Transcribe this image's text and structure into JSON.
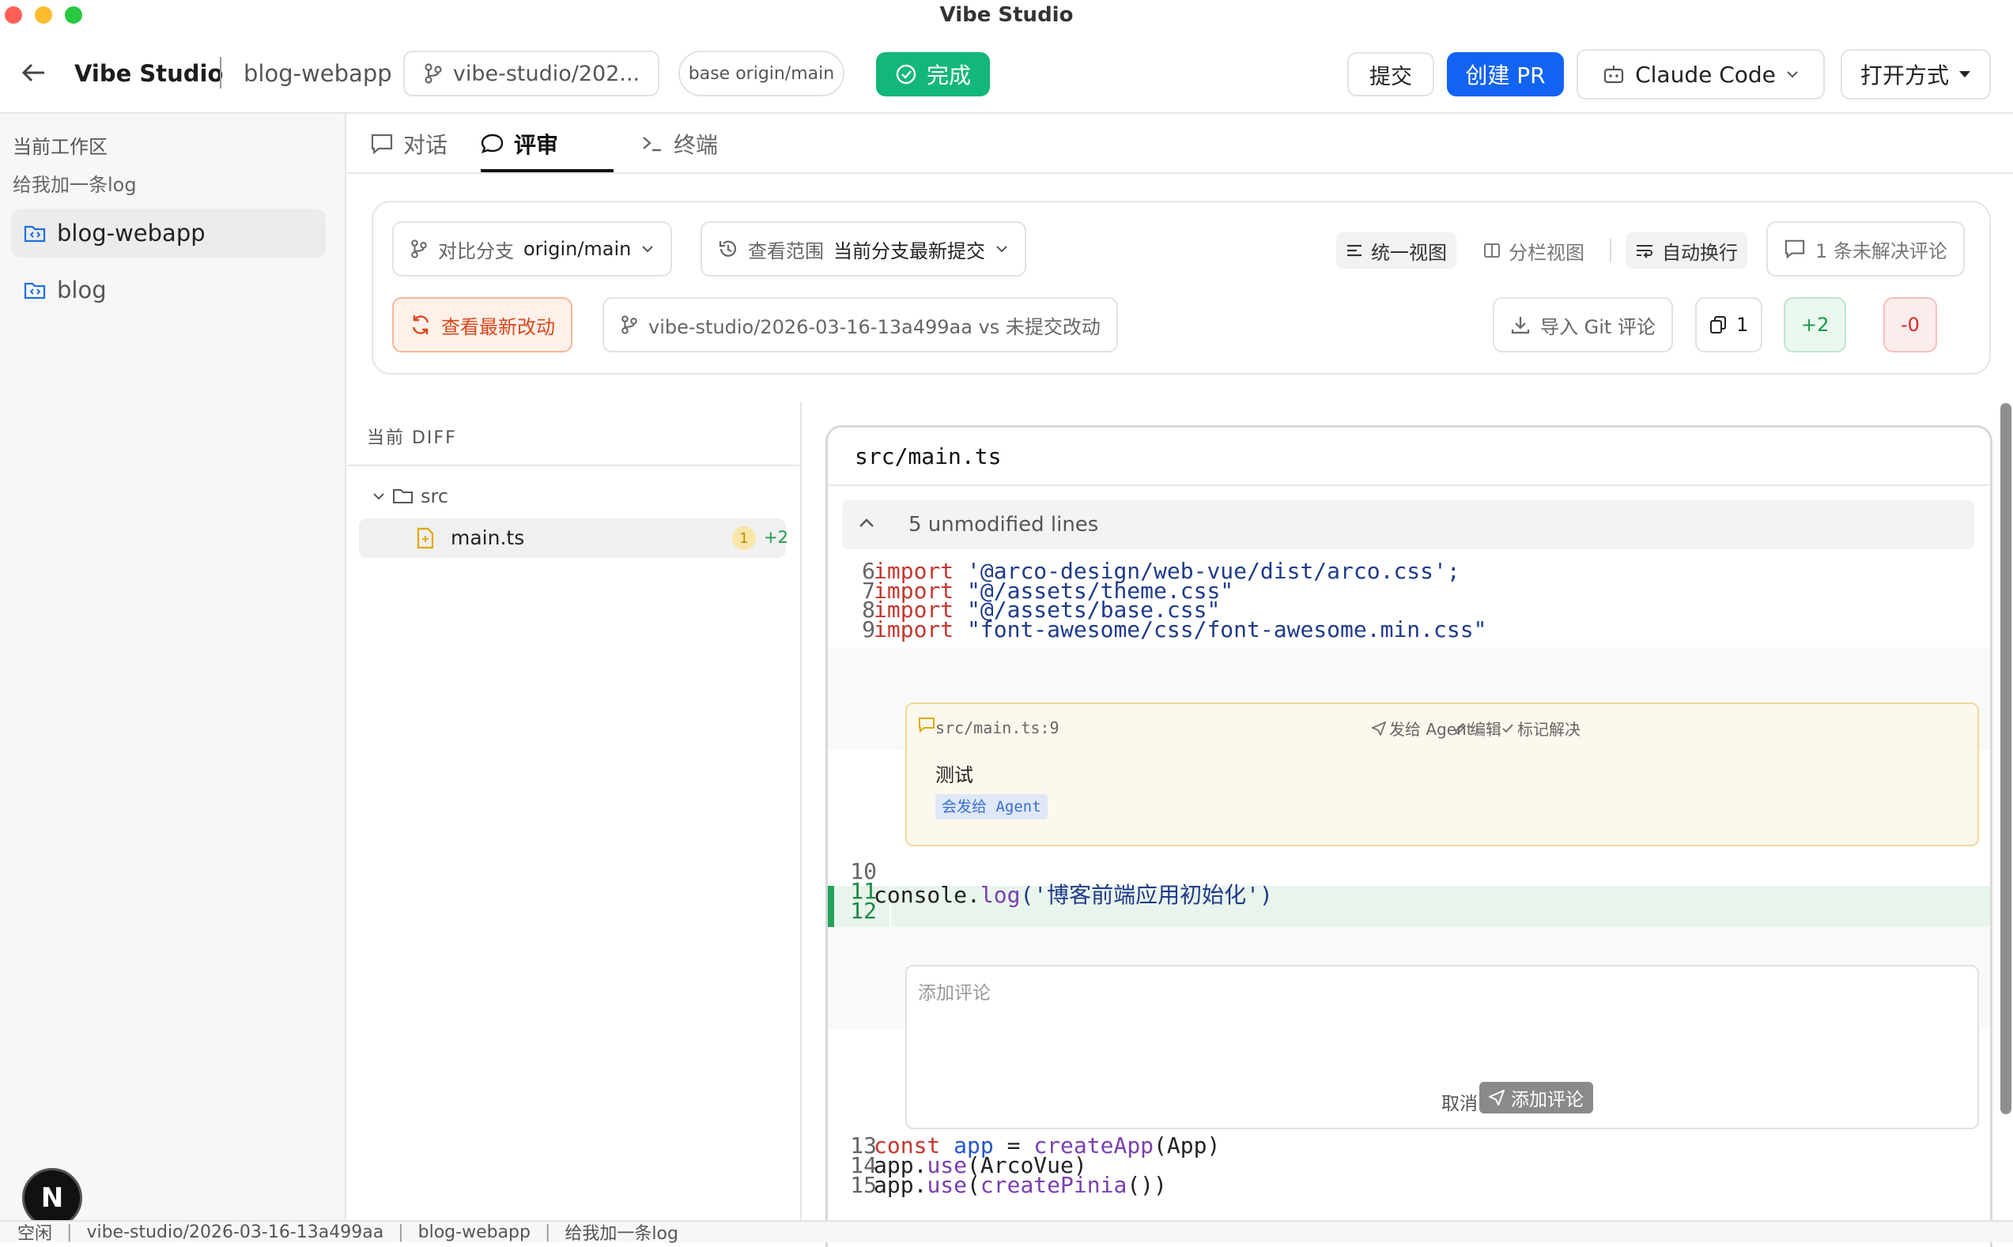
{
  "window": {
    "title": "Vibe Studio"
  },
  "header": {
    "app_name": "Vibe Studio",
    "project": "blog-webapp",
    "branch": "vibe-studio/202...",
    "base": "base origin/main",
    "done_label": "完成",
    "commit_label": "提交",
    "create_pr_label": "创建 PR",
    "agent_label": "Claude Code",
    "open_with_label": "打开方式"
  },
  "sidebar": {
    "section_title": "当前工作区",
    "task": "给我加一条log",
    "items": [
      {
        "label": "blog-webapp"
      },
      {
        "label": "blog"
      }
    ],
    "avatar": "N"
  },
  "tabs": [
    {
      "label": "对话"
    },
    {
      "label": "评审"
    },
    {
      "label": "终端"
    }
  ],
  "review": {
    "compare_prefix": "对比分支",
    "compare_value": "origin/main",
    "scope_prefix": "查看范围",
    "scope_value": "当前分支最新提交",
    "view_unified": "统一视图",
    "view_split": "分栏视图",
    "auto_wrap": "自动换行",
    "unresolved": "1 条未解决评论",
    "refresh": "查看最新改动",
    "range_label": "vibe-studio/2026-03-16-13a499aa vs 未提交改动",
    "import_git": "导入 Git 评论",
    "files_count": "1",
    "additions": "+2",
    "deletions": "-0"
  },
  "filetree": {
    "title": "当前 DIFF",
    "folder": "src",
    "file": "main.ts",
    "file_comments": "1",
    "file_additions": "+2"
  },
  "diff": {
    "file_path": "src/main.ts",
    "collapsed": "5 unmodified lines",
    "lines_top": [
      {
        "n": "6",
        "kw": "import",
        "rest": " '@arco-design/web-vue/dist/arco.css';"
      },
      {
        "n": "7",
        "kw": "import",
        "rest": " \"@/assets/theme.css\""
      },
      {
        "n": "8",
        "kw": "import",
        "rest": " \"@/assets/base.css\""
      },
      {
        "n": "9",
        "kw": "import",
        "rest": " \"font-awesome/css/font-awesome.min.css\""
      }
    ],
    "comment": {
      "location": "src/main.ts:9",
      "send_agent": "发给 Agent",
      "edit": "编辑",
      "resolve": "标记解决",
      "body": "测试",
      "tag": "会发给 Agent"
    },
    "line10": "10",
    "line11": "11",
    "line12": "12",
    "added_code_obj": "console",
    "added_code_fn": "log",
    "added_code_arg": "('博客前端应用初始化')",
    "new_comment": {
      "placeholder": "添加评论",
      "cancel": "取消",
      "submit": "添加评论"
    },
    "lines_bottom": [
      {
        "n": "13"
      },
      {
        "n": "14"
      },
      {
        "n": "15"
      }
    ]
  },
  "statusbar": {
    "state": "空闲",
    "branch": "vibe-studio/2026-03-16-13a499aa",
    "project": "blog-webapp",
    "task": "给我加一条log"
  }
}
